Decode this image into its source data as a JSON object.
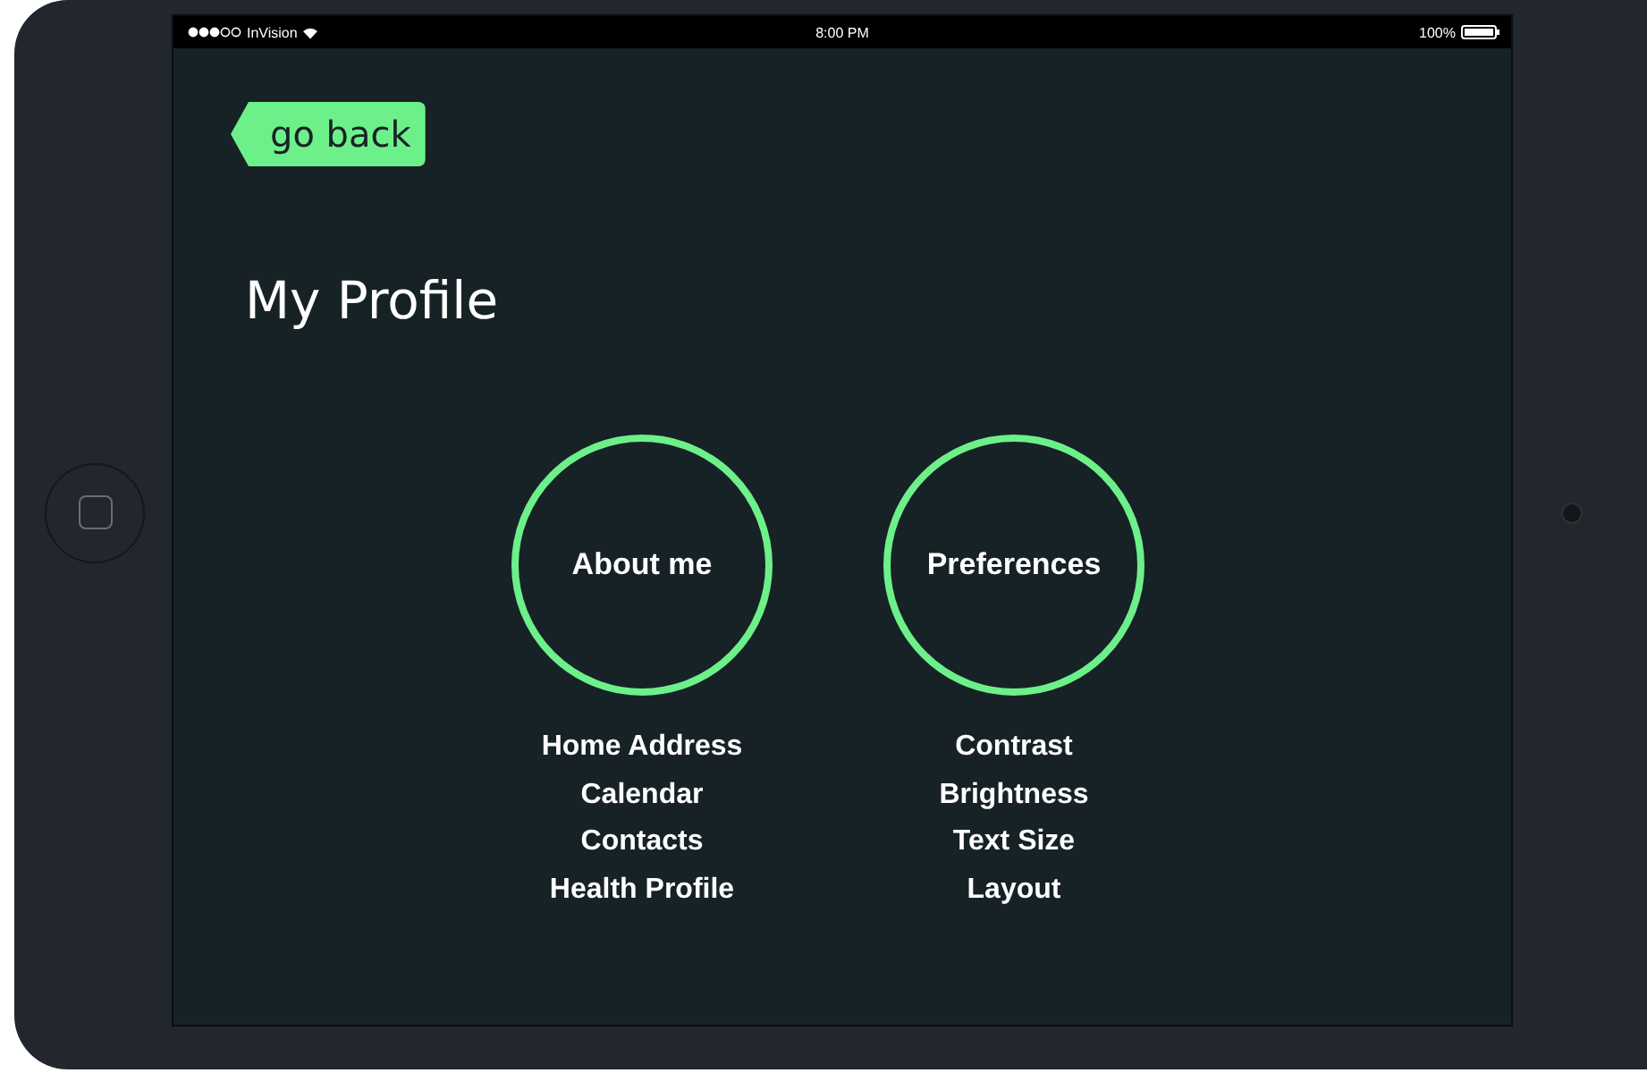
{
  "status_bar": {
    "carrier": "InVision",
    "time": "8:00 PM",
    "battery": "100%"
  },
  "back_button": {
    "label": "go back"
  },
  "title": "My Profile",
  "sections": [
    {
      "title": "About me",
      "items": [
        "Home Address",
        "Calendar",
        "Contacts",
        "Health Profile"
      ]
    },
    {
      "title": "Preferences",
      "items": [
        "Contrast",
        "Brightness",
        "Text Size",
        "Layout"
      ]
    }
  ]
}
